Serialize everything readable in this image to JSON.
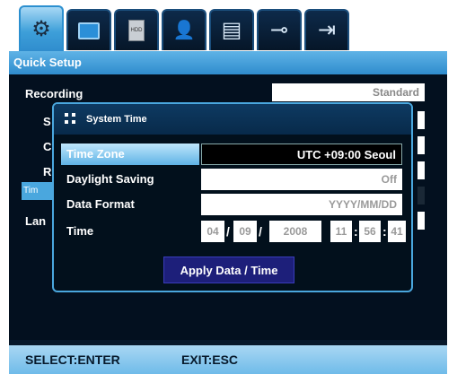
{
  "tabs": [
    {
      "icon": "gear-icon",
      "glyph": "⚙"
    },
    {
      "icon": "monitor-icon",
      "glyph": ""
    },
    {
      "icon": "hdd-icon",
      "glyph": "HDD"
    },
    {
      "icon": "user-network-icon",
      "glyph": "👤"
    },
    {
      "icon": "screen-settings-icon",
      "glyph": "▤"
    },
    {
      "icon": "toggle-settings-icon",
      "glyph": "⊸"
    },
    {
      "icon": "exit-door-icon",
      "glyph": "⇥"
    }
  ],
  "header": {
    "title": "Quick Setup"
  },
  "background": {
    "recording_label": "Recording",
    "recording_value": "Standard",
    "partial_labels": [
      "S",
      "C",
      "R",
      "Tim",
      "Lan"
    ]
  },
  "dialog": {
    "title": "System Time",
    "rows": [
      {
        "label": "Time Zone",
        "value": "UTC +09:00 Seoul",
        "selected": true
      },
      {
        "label": "Daylight Saving",
        "value": "Off"
      },
      {
        "label": "Data Format",
        "value": "YYYY/MM/DD"
      }
    ],
    "time": {
      "label": "Time",
      "month": "04",
      "day": "09",
      "year": "2008",
      "hour": "11",
      "minute": "56",
      "second": "41",
      "date_sep": "/",
      "time_sep": ":"
    },
    "apply_label": "Apply Data / Time"
  },
  "footer": {
    "select_hint": "SELECT:ENTER",
    "exit_hint": "EXIT:ESC"
  },
  "colors": {
    "accent": "#4aa7de",
    "panel_bg": "#03101f",
    "button_bg": "#1d1f7a"
  }
}
